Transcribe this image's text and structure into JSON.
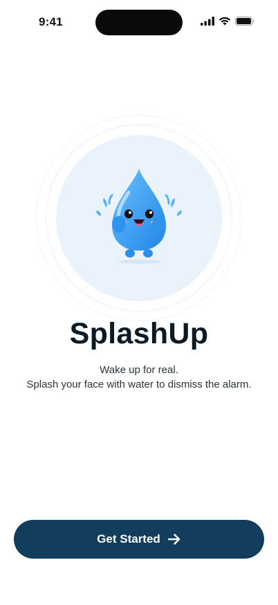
{
  "status_bar": {
    "time": "9:41",
    "icons": [
      "cellular-signal-icon",
      "wifi-icon",
      "battery-icon"
    ]
  },
  "hero": {
    "mascot": "water-drop-mascot-icon"
  },
  "app": {
    "title": "SplashUp",
    "tagline_line1": "Wake up for real.",
    "tagline_line2": "Splash your face with water to dismiss the alarm."
  },
  "cta": {
    "label": "Get Started",
    "icon": "arrow-right-icon"
  },
  "colors": {
    "primary": "#123d5c",
    "drop": "#3b9df2",
    "hero_bg": "#eaf3fb",
    "title": "#0c1a26"
  }
}
